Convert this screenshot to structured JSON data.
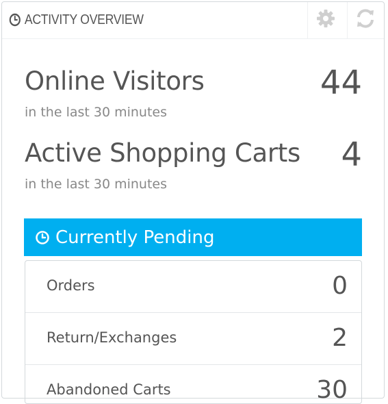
{
  "header": {
    "title": "ACTIVITY OVERVIEW",
    "icons": [
      "clock-icon",
      "gear-icon",
      "refresh-icon"
    ]
  },
  "metrics": [
    {
      "label": "Online Visitors",
      "value": "44",
      "subtitle": "in the last 30 minutes"
    },
    {
      "label": "Active Shopping Carts",
      "value": "4",
      "subtitle": "in the last 30 minutes"
    }
  ],
  "pending": {
    "title": "Currently Pending",
    "color": "#00aff0",
    "items": [
      {
        "label": "Orders",
        "count": "0"
      },
      {
        "label": "Return/Exchanges",
        "count": "2"
      },
      {
        "label": "Abandoned Carts",
        "count": "30"
      }
    ]
  }
}
